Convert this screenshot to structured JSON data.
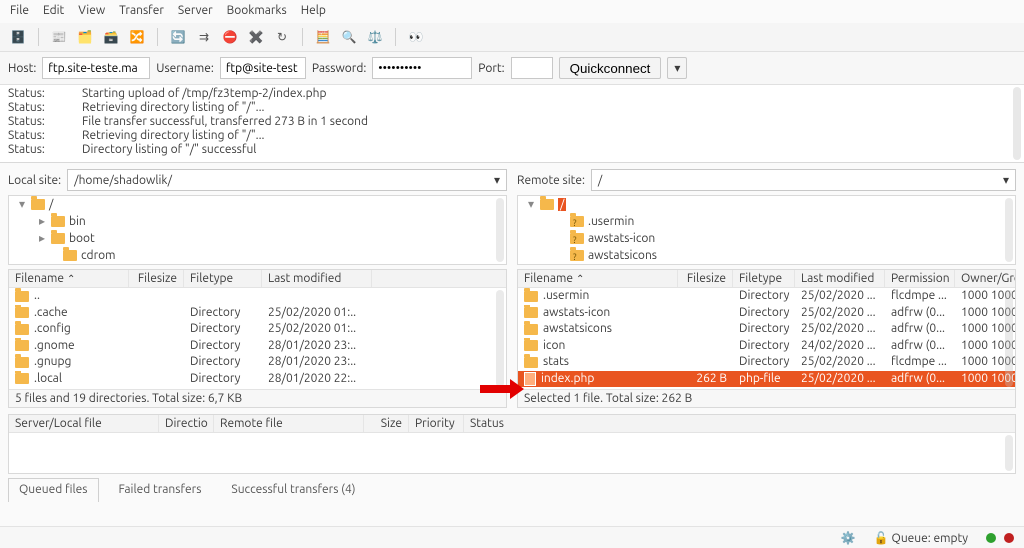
{
  "menu": [
    "File",
    "Edit",
    "View",
    "Transfer",
    "Server",
    "Bookmarks",
    "Help"
  ],
  "quick": {
    "host_lbl": "Host:",
    "host_val": "ftp.site-teste.ma",
    "user_lbl": "Username:",
    "user_val": "ftp@site-test",
    "pass_lbl": "Password:",
    "pass_val": "••••••••••",
    "port_lbl": "Port:",
    "port_val": "",
    "qc_lbl": "Quickconnect"
  },
  "log": [
    {
      "k": "Status:",
      "v": "Starting upload of /tmp/fz3temp-2/index.php"
    },
    {
      "k": "Status:",
      "v": "Retrieving directory listing of \"/\"..."
    },
    {
      "k": "Status:",
      "v": "File transfer successful, transferred 273 B in 1 second"
    },
    {
      "k": "Status:",
      "v": "Retrieving directory listing of \"/\"..."
    },
    {
      "k": "Status:",
      "v": "Directory listing of \"/\" successful"
    }
  ],
  "local": {
    "site_lbl": "Local site:",
    "site_val": "/home/shadowlik/",
    "tree": [
      {
        "tw": "▾",
        "ic": "fold",
        "txt": "/",
        "ind": 8
      },
      {
        "tw": "▸",
        "ic": "fold",
        "txt": "bin",
        "ind": 28
      },
      {
        "tw": "▸",
        "ic": "fold",
        "txt": "boot",
        "ind": 28
      },
      {
        "tw": "",
        "ic": "fold",
        "txt": "cdrom",
        "ind": 40
      }
    ],
    "cols": {
      "name": "Filename",
      "size": "Filesize",
      "type": "Filetype",
      "mod": "Last modified"
    },
    "w": {
      "name": 120,
      "size": 55,
      "type": 78,
      "mod": 110
    },
    "rows": [
      {
        "name": "..",
        "size": "",
        "type": "",
        "mod": "",
        "ic": "fold"
      },
      {
        "name": ".cache",
        "size": "",
        "type": "Directory",
        "mod": "25/02/2020 01:..",
        "ic": "fold"
      },
      {
        "name": ".config",
        "size": "",
        "type": "Directory",
        "mod": "25/02/2020 01:..",
        "ic": "fold"
      },
      {
        "name": ".gnome",
        "size": "",
        "type": "Directory",
        "mod": "28/01/2020 23:..",
        "ic": "fold"
      },
      {
        "name": ".gnupg",
        "size": "",
        "type": "Directory",
        "mod": "28/01/2020 23:..",
        "ic": "fold"
      },
      {
        "name": ".local",
        "size": "",
        "type": "Directory",
        "mod": "28/01/2020 22:..",
        "ic": "fold"
      }
    ],
    "summary": "5 files and 19 directories. Total size: 6,7 KB"
  },
  "remote": {
    "site_lbl": "Remote site:",
    "site_val": "/",
    "tree": [
      {
        "tw": "▾",
        "ic": "fold",
        "txt": "/",
        "ind": 8,
        "sel": true
      },
      {
        "tw": "",
        "ic": "q",
        "txt": ".usermin",
        "ind": 38
      },
      {
        "tw": "",
        "ic": "q",
        "txt": "awstats-icon",
        "ind": 38
      },
      {
        "tw": "",
        "ic": "q",
        "txt": "awstatsicons",
        "ind": 38
      }
    ],
    "cols": {
      "name": "Filename",
      "size": "Filesize",
      "type": "Filetype",
      "mod": "Last modified",
      "perm": "Permission",
      "own": "Owner/Gro"
    },
    "w": {
      "name": 160,
      "size": 55,
      "type": 62,
      "mod": 90,
      "perm": 70,
      "own": 60
    },
    "rows": [
      {
        "name": ".usermin",
        "size": "",
        "type": "Directory",
        "mod": "25/02/2020 ...",
        "perm": "flcdmpe ...",
        "own": "1000 1000",
        "ic": "fold"
      },
      {
        "name": "awstats-icon",
        "size": "",
        "type": "Directory",
        "mod": "25/02/2020 ...",
        "perm": "adfrw (0...",
        "own": "1000 1000",
        "ic": "fold"
      },
      {
        "name": "awstatsicons",
        "size": "",
        "type": "Directory",
        "mod": "25/02/2020 ...",
        "perm": "adfrw (0...",
        "own": "1000 1000",
        "ic": "fold"
      },
      {
        "name": "icon",
        "size": "",
        "type": "Directory",
        "mod": "24/02/2020 ...",
        "perm": "adfrw (0...",
        "own": "1000 1000",
        "ic": "fold"
      },
      {
        "name": "stats",
        "size": "",
        "type": "Directory",
        "mod": "25/02/2020 ...",
        "perm": "flcdmpe ...",
        "own": "1000 1000",
        "ic": "fold"
      },
      {
        "name": "index.php",
        "size": "262 B",
        "type": "php-file",
        "mod": "25/02/2020 ...",
        "perm": "adfrw (0...",
        "own": "1000 1000",
        "ic": "page",
        "sel": true
      }
    ],
    "summary": "Selected 1 file. Total size: 262 B"
  },
  "tq_cols": [
    "Server/Local file",
    "Directio",
    "Remote file",
    "Size",
    "Priority",
    "Status"
  ],
  "tabs": {
    "queued": "Queued files",
    "failed": "Failed transfers",
    "ok": "Successful transfers (4)"
  },
  "status": {
    "queue_lbl": "Queue: empty"
  },
  "colors": {
    "accent": "#e95420",
    "green": "#2ea02e",
    "red": "#c02020"
  }
}
